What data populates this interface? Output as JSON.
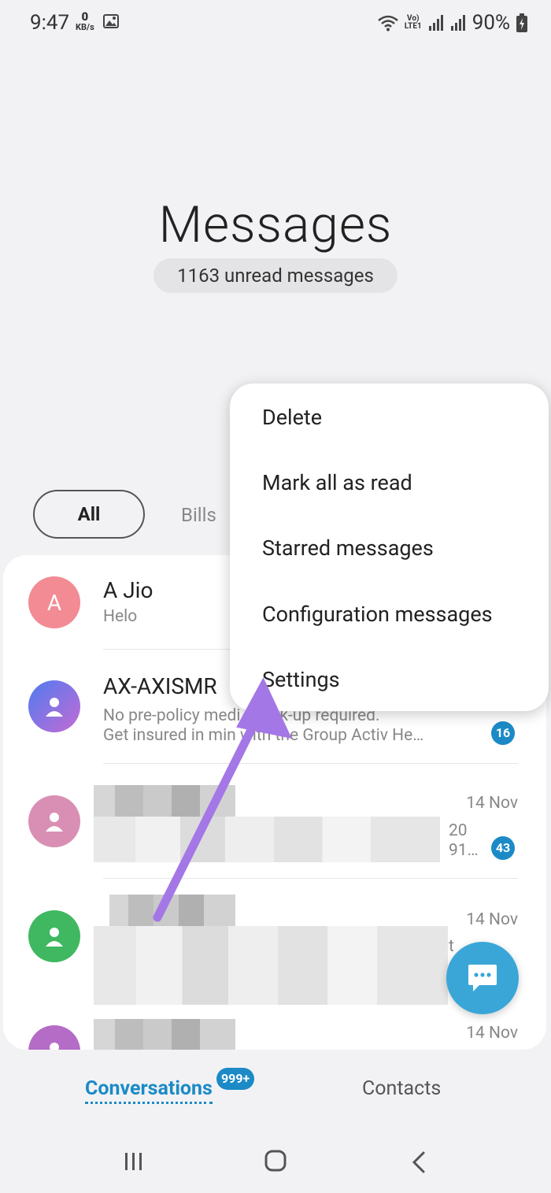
{
  "status_bar": {
    "time": "9:47",
    "net_speed_value": "0",
    "net_speed_unit": "KB/s",
    "volte_label": "Vo)",
    "lte_label": "LTE1",
    "battery": "90%"
  },
  "header": {
    "title": "Messages",
    "unread": "1163 unread messages"
  },
  "filters": {
    "all": "All",
    "bills": "Bills"
  },
  "menu": {
    "items": [
      "Delete",
      "Mark all as read",
      "Starred messages",
      "Configuration messages",
      "Settings"
    ]
  },
  "conversations": [
    {
      "avatar_letter": "A",
      "name": "A Jio",
      "preview": "Helo",
      "avatar_color": "#f28b94"
    },
    {
      "name": "AX-AXISMR",
      "preview_line1": "No pre-policy medi",
      "preview_line1b": "check-up required.",
      "preview_line2": "Get insured in min",
      "preview_line2b": "with the Group Activ He…",
      "badge": "16",
      "avatar_color": "#7a67d8"
    },
    {
      "date": "14 Nov",
      "preview_tail1": "20",
      "preview_tail2": "91…",
      "badge": "43",
      "avatar_color": "#d98fb3"
    },
    {
      "date": "14 Nov",
      "preview_tail1": "t",
      "avatar_color": "#3fb861"
    },
    {
      "date": "14 Nov",
      "avatar_color": "#b46cc7"
    }
  ],
  "tabs": {
    "conversations": "Conversations",
    "conversations_badge": "999+",
    "contacts": "Contacts"
  },
  "colors": {
    "accent": "#1b8ac6",
    "fab": "#3aa6d8",
    "arrow": "#a477e6"
  }
}
